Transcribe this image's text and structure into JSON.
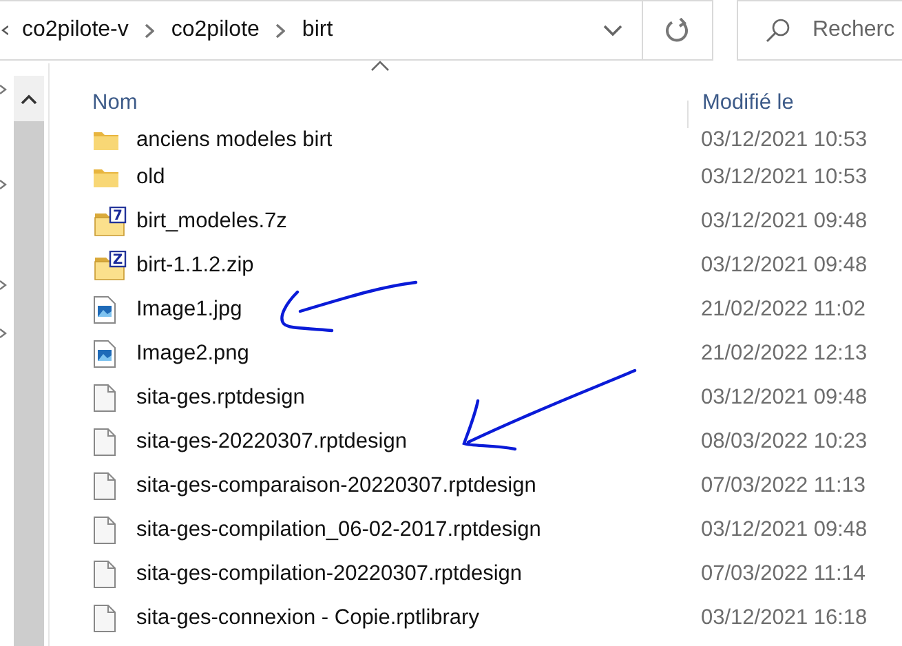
{
  "address_bar": {
    "path": [
      "co2pilote-v",
      "co2pilote",
      "birt"
    ]
  },
  "search": {
    "placeholder": "Recherc"
  },
  "columns": [
    {
      "label": "Nom",
      "sorted": true
    },
    {
      "label": "Modifié le",
      "sorted": false
    }
  ],
  "files": [
    {
      "name": "anciens modeles birt",
      "kind": "folder",
      "modified": "03/12/2021 10:53"
    },
    {
      "name": "old",
      "kind": "folder",
      "modified": "03/12/2021 10:53"
    },
    {
      "name": "birt_modeles.7z",
      "kind": "archive",
      "badge": "7",
      "modified": "03/12/2021 09:48"
    },
    {
      "name": "birt-1.1.2.zip",
      "kind": "archive",
      "badge": "Z",
      "modified": "03/12/2021 09:48"
    },
    {
      "name": "Image1.jpg",
      "kind": "image",
      "modified": "21/02/2022 11:02"
    },
    {
      "name": "Image2.png",
      "kind": "image",
      "modified": "21/02/2022 12:13"
    },
    {
      "name": "sita-ges.rptdesign",
      "kind": "file",
      "modified": "03/12/2021 09:48"
    },
    {
      "name": "sita-ges-20220307.rptdesign",
      "kind": "file",
      "modified": "08/03/2022 10:23"
    },
    {
      "name": "sita-ges-comparaison-20220307.rptdesign",
      "kind": "file",
      "modified": "07/03/2022 11:13"
    },
    {
      "name": "sita-ges-compilation_06-02-2017.rptdesign",
      "kind": "file",
      "modified": "03/12/2021 09:48"
    },
    {
      "name": "sita-ges-compilation-20220307.rptdesign",
      "kind": "file",
      "modified": "07/03/2022 11:14"
    },
    {
      "name": "sita-ges-connexion - Copie.rptlibrary",
      "kind": "file",
      "modified": "03/12/2021 16:18"
    }
  ]
}
